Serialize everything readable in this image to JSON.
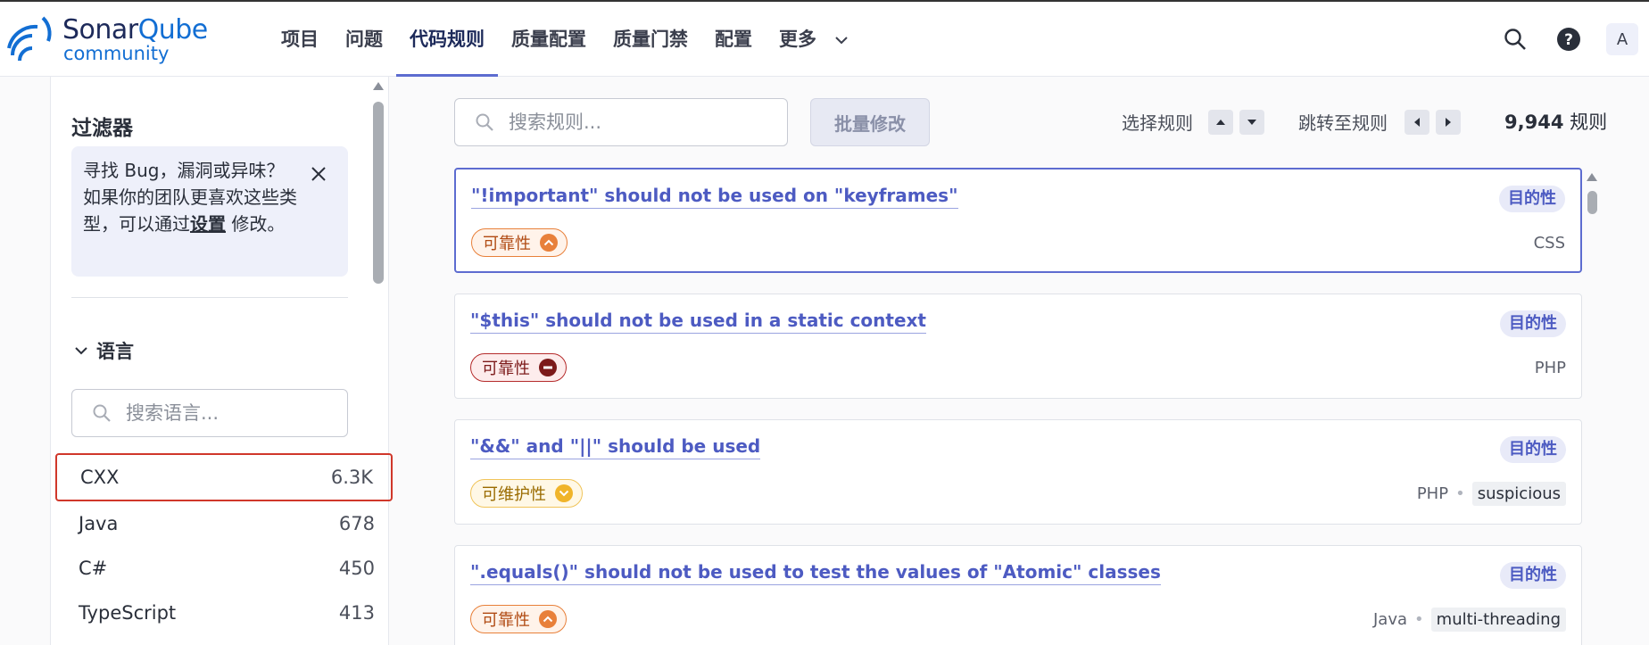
{
  "brand": {
    "name_part1": "Sonar",
    "name_part2": "Qube",
    "edition": "community"
  },
  "nav": {
    "items": [
      {
        "label": "项目"
      },
      {
        "label": "问题"
      },
      {
        "label": "代码规则"
      },
      {
        "label": "质量配置"
      },
      {
        "label": "质量门禁"
      },
      {
        "label": "配置"
      },
      {
        "label": "更多"
      }
    ],
    "active_index": 2,
    "avatar_letter": "A"
  },
  "sidebar": {
    "title": "过滤器",
    "hint_text": "寻找 Bug，漏洞或异味？如果你的团队更喜欢这些类型，可以通过",
    "hint_link": "设置",
    "hint_tail": " 修改。",
    "language_section": "语言",
    "language_search_placeholder": "搜索语言...",
    "languages": [
      {
        "name": "CXX",
        "count": "6.3K"
      },
      {
        "name": "Java",
        "count": "678"
      },
      {
        "name": "C#",
        "count": "450"
      },
      {
        "name": "TypeScript",
        "count": "413"
      }
    ]
  },
  "toolbar": {
    "search_placeholder": "搜索规则...",
    "bulk_change": "批量修改",
    "select_rules": "选择规则",
    "jump_to_rule": "跳转至规则",
    "total_count": "9,944",
    "total_unit": "规则"
  },
  "rules": [
    {
      "title": "\"!important\" should not be used on \"keyframes\"",
      "purpose": "目的性",
      "quality": "可靠性",
      "severity": "high",
      "language": "CSS",
      "tag": ""
    },
    {
      "title": "\"$this\" should not be used in a static context",
      "purpose": "目的性",
      "quality": "可靠性",
      "severity": "blocker",
      "language": "PHP",
      "tag": ""
    },
    {
      "title": "\"&&\" and \"||\" should be used",
      "purpose": "目的性",
      "quality": "可维护性",
      "severity": "low",
      "language": "PHP",
      "tag": "suspicious"
    },
    {
      "title": "\".equals()\" should not be used to test the values of \"Atomic\" classes",
      "purpose": "目的性",
      "quality": "可靠性",
      "severity": "high",
      "language": "Java",
      "tag": "multi-threading"
    }
  ],
  "colors": {
    "accent": "#5d6cd0",
    "link": "#4d5bc2",
    "selected_outline": "#d0372a"
  }
}
